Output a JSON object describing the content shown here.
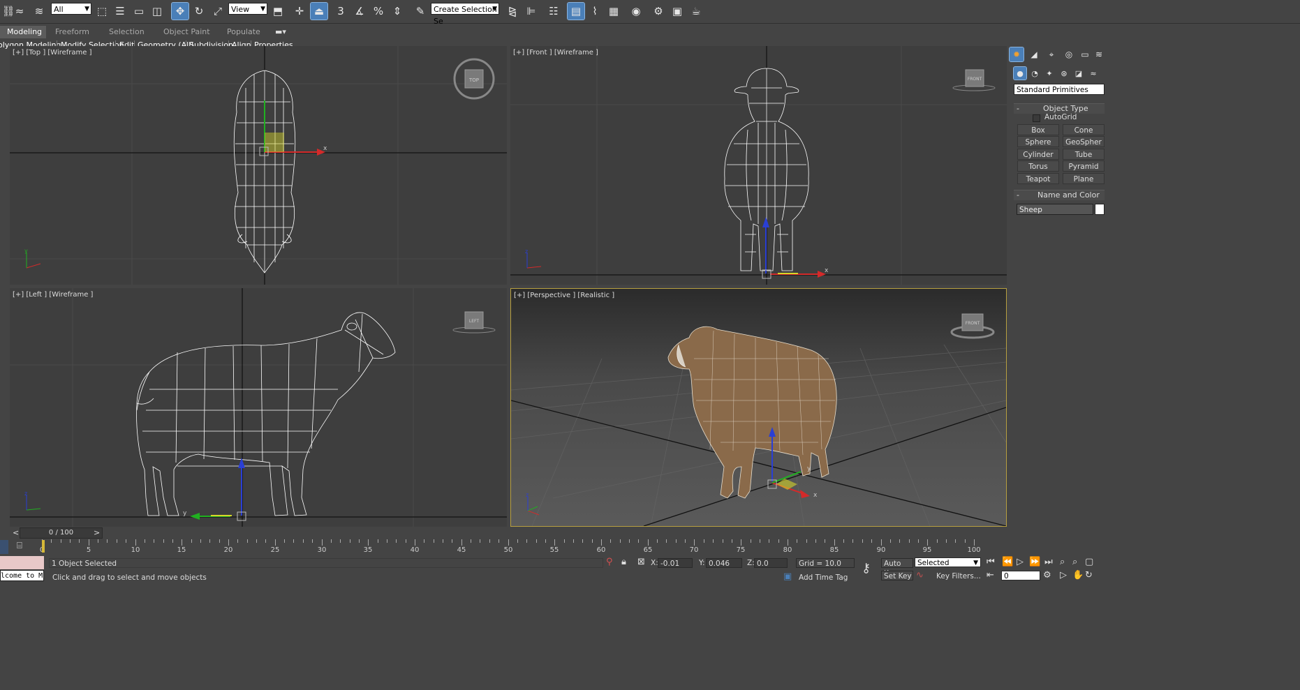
{
  "toolbar": {
    "selection_filter": "All",
    "reference_coord": "View",
    "named_selection_placeholder": "Create Selection Se",
    "snap_labels": {
      "snap": "3",
      "percent": "%"
    }
  },
  "ribbon": {
    "tabs": [
      "Modeling",
      "Freeform",
      "Selection",
      "Object Paint",
      "Populate"
    ],
    "active_tab": "Modeling",
    "subtabs": [
      "olygon Modeling",
      "Modify Selection",
      "Edit",
      "Geometry (All)",
      "Subdivision",
      "Align",
      "Properties"
    ]
  },
  "viewports": {
    "top": {
      "label": "[+] [Top ] [Wireframe ]",
      "cube": "TOP"
    },
    "front": {
      "label": "[+] [Front ] [Wireframe ]",
      "cube": "FRONT"
    },
    "left": {
      "label": "[+] [Left ] [Wireframe ]",
      "cube": "LEFT"
    },
    "perspective": {
      "label": "[+] [Perspective ] [Realistic ]",
      "cube": "FRONT"
    }
  },
  "axes": {
    "x": "x",
    "y": "y",
    "z": "z"
  },
  "command_panel": {
    "category": "Standard Primitives",
    "object_type_title": "Object Type",
    "autogrid_label": "AutoGrid",
    "buttons": [
      "Box",
      "Cone",
      "Sphere",
      "GeoSpher",
      "Cylinder",
      "Tube",
      "Torus",
      "Pyramid",
      "Teapot",
      "Plane"
    ],
    "name_color_title": "Name and Color",
    "object_name": "Sheep"
  },
  "timeline": {
    "frame_display": "0 / 100",
    "ticks": [
      "0",
      "5",
      "10",
      "15",
      "20",
      "25",
      "30",
      "35",
      "40",
      "45",
      "50",
      "55",
      "60",
      "65",
      "70",
      "75",
      "80",
      "85",
      "90",
      "95",
      "100"
    ]
  },
  "status": {
    "maxscript": "lcome to M",
    "selection_info": "1 Object Selected",
    "prompt": "Click and drag to select and move objects",
    "x_label": "X:",
    "x_value": "-0.01",
    "y_label": "Y:",
    "y_value": "0.046",
    "z_label": "Z:",
    "z_value": "0.0",
    "grid": "Grid = 10.0",
    "add_time_tag": "Add Time Tag",
    "auto_key": "Auto Key",
    "set_key": "Set Key",
    "key_mode": "Selected",
    "key_filters": "Key Filters...",
    "current_frame": "0"
  },
  "colors": {
    "x_axis": "#d42a2a",
    "y_axis": "#20b020",
    "z_axis": "#2a3fd4",
    "active_viewport_border": "#b8a040",
    "toolbar_active": "#4a7fb8"
  }
}
